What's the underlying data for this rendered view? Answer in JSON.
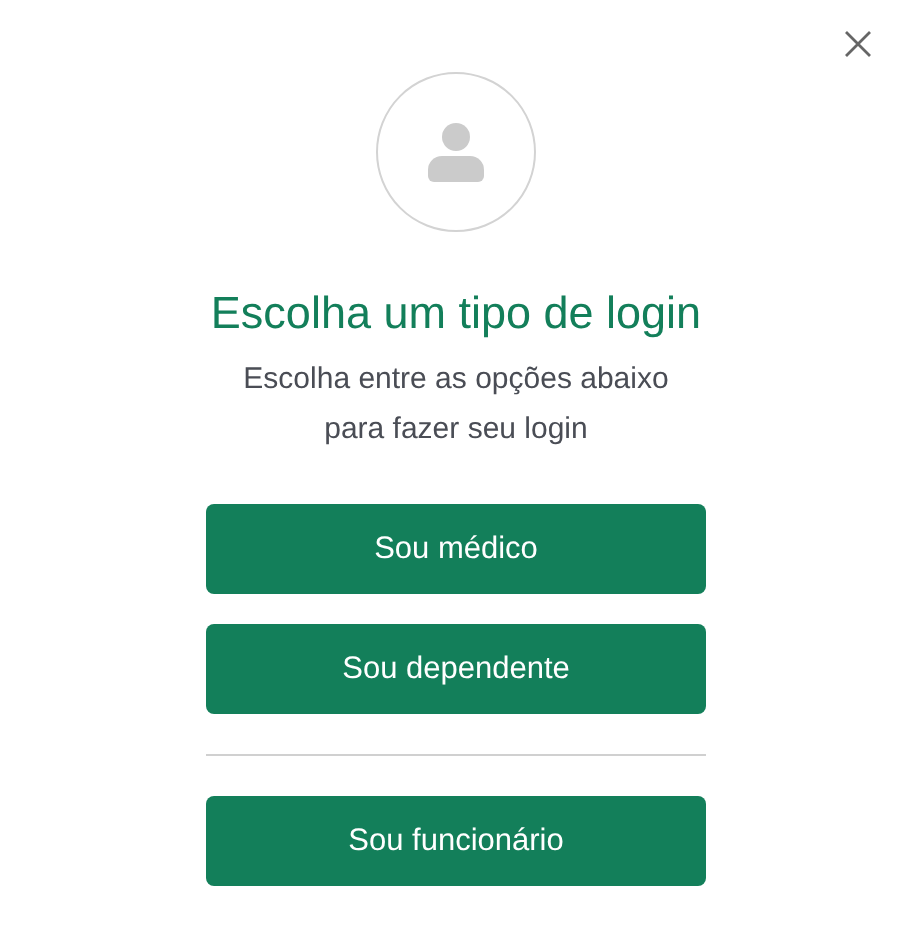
{
  "dialog": {
    "title": "Escolha um tipo de login",
    "subtitle_lines": [
      "Escolha entre as opções abaixo",
      "para fazer seu login"
    ]
  },
  "button_groups": [
    [
      "Sou médico",
      "Sou dependente"
    ],
    [
      "Sou funcionário"
    ]
  ]
}
